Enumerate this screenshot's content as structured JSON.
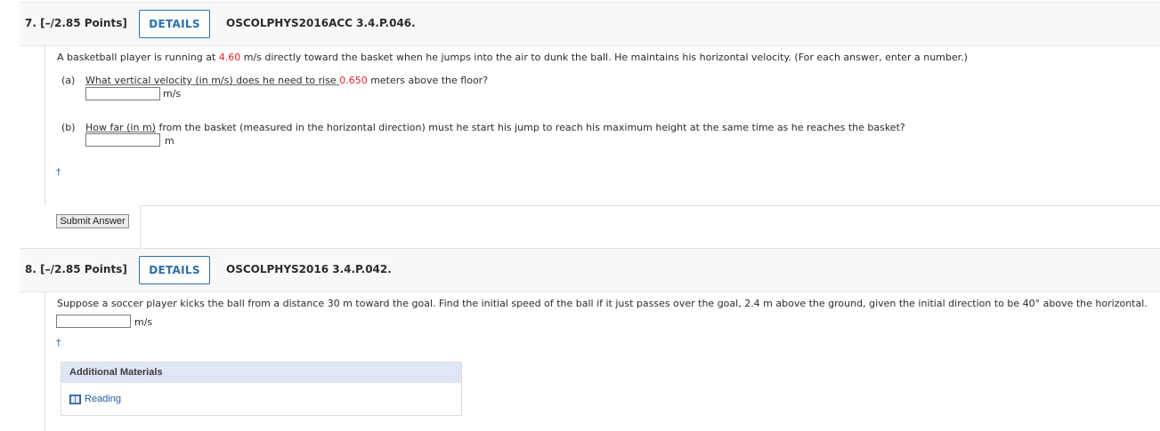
{
  "questions": [
    {
      "number": "7.",
      "points": "[–/2.85 Points]",
      "details_label": "DETAILS",
      "code": "OSCOLPHYS2016ACC 3.4.P.046.",
      "prompt_parts": {
        "p1": "A basketball player is running at ",
        "speed": "4.60",
        "p2": " m/s directly toward the basket when he jumps into the air to dunk the ball. He maintains his horizontal velocity. (For each answer, enter a number.)"
      },
      "part_a": {
        "label": "(a)",
        "q1": "What vertical velocity (in m/s) does he need to rise ",
        "height": "0.650",
        "q2": " meters above the floor?",
        "unit": "m/s",
        "value": ""
      },
      "part_b": {
        "label": "(b)",
        "q_underlined": "How far (in m)",
        "q_rest": " from the basket (measured in the horizontal direction) must he start his jump to reach his maximum height at the same time as he reaches the basket?",
        "unit": "m",
        "value": ""
      },
      "dagger": "†",
      "submit_label": "Submit Answer"
    },
    {
      "number": "8.",
      "points": "[–/2.85 Points]",
      "details_label": "DETAILS",
      "code": "OSCOLPHYS2016 3.4.P.042.",
      "prompt": "Suppose a soccer player kicks the ball from a distance 30 m toward the goal. Find the initial speed of the ball if it just passes over the goal, 2.4 m above the ground, given the initial direction to be 40° above the horizontal.",
      "unit": "m/s",
      "value": "",
      "dagger": "†",
      "additional_materials": {
        "title": "Additional Materials",
        "items": [
          {
            "label": "Reading",
            "icon": "book-icon"
          }
        ]
      }
    }
  ],
  "colors": {
    "accent": "#2b6ea6",
    "highlight": "#e0222a",
    "panel_header": "#dfe6f5"
  }
}
